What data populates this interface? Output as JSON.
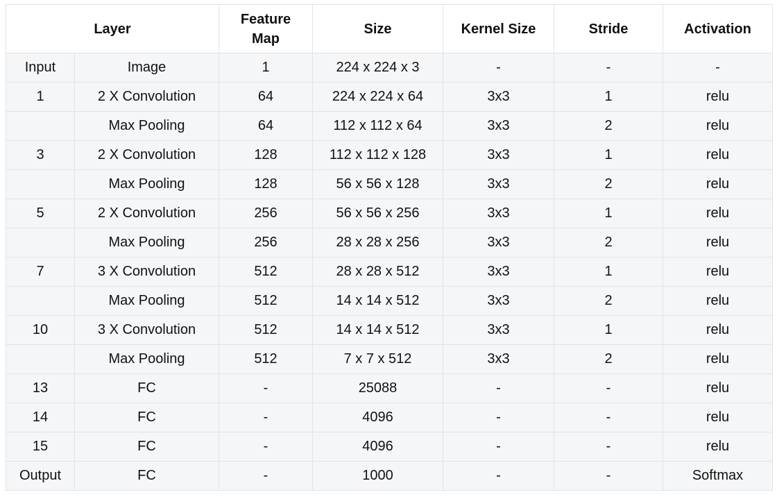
{
  "headers": [
    "Layer",
    "Feature Map",
    "Size",
    "Kernel Size",
    "Stride",
    "Activation"
  ],
  "rows": [
    [
      "Input",
      "Image",
      "1",
      "224 x 224 x 3",
      "-",
      "-",
      "-"
    ],
    [
      "1",
      "2 X Convolution",
      "64",
      "224 x 224 x 64",
      "3x3",
      "1",
      "relu"
    ],
    [
      "",
      "Max Pooling",
      "64",
      "112 x 112 x 64",
      "3x3",
      "2",
      "relu"
    ],
    [
      "3",
      "2 X Convolution",
      "128",
      "112 x 112 x 128",
      "3x3",
      "1",
      "relu"
    ],
    [
      "",
      "Max Pooling",
      "128",
      "56 x 56 x 128",
      "3x3",
      "2",
      "relu"
    ],
    [
      "5",
      "2 X Convolution",
      "256",
      "56 x 56 x 256",
      "3x3",
      "1",
      "relu"
    ],
    [
      "",
      "Max Pooling",
      "256",
      "28 x 28 x 256",
      "3x3",
      "2",
      "relu"
    ],
    [
      "7",
      "3 X Convolution",
      "512",
      "28 x 28 x 512",
      "3x3",
      "1",
      "relu"
    ],
    [
      "",
      "Max Pooling",
      "512",
      "14 x 14 x 512",
      "3x3",
      "2",
      "relu"
    ],
    [
      "10",
      "3 X Convolution",
      "512",
      "14 x 14 x 512",
      "3x3",
      "1",
      "relu"
    ],
    [
      "",
      "Max Pooling",
      "512",
      "7 x 7 x 512",
      "3x3",
      "2",
      "relu"
    ],
    [
      "13",
      "FC",
      "-",
      "25088",
      "-",
      "-",
      "relu"
    ],
    [
      "14",
      "FC",
      "-",
      "4096",
      "-",
      "-",
      "relu"
    ],
    [
      "15",
      "FC",
      "-",
      "4096",
      "-",
      "-",
      "relu"
    ],
    [
      "Output",
      "FC",
      "-",
      "1000",
      "-",
      "-",
      "Softmax"
    ]
  ]
}
